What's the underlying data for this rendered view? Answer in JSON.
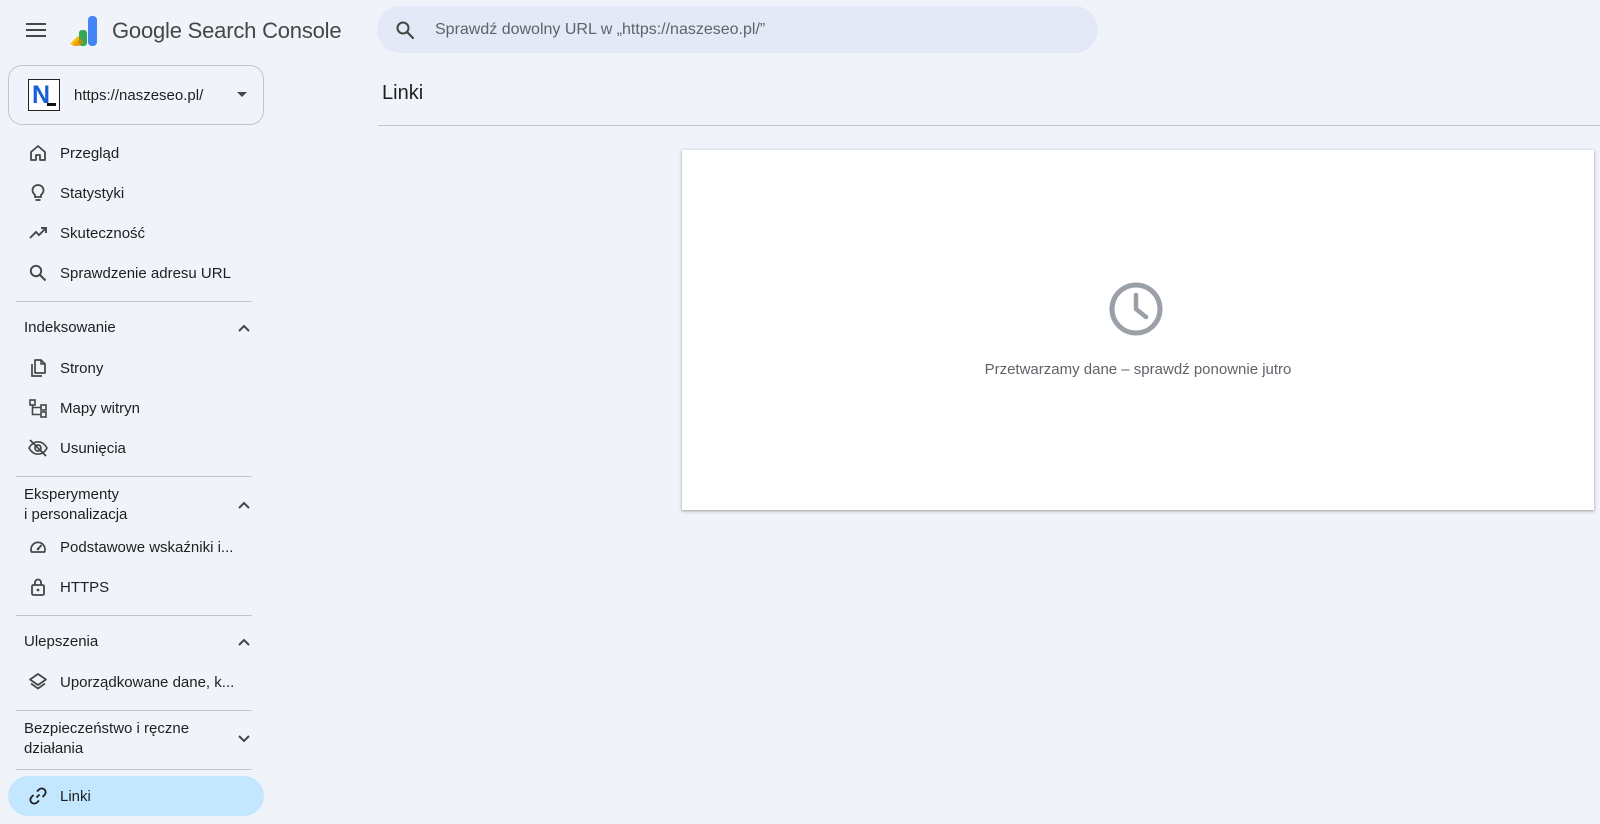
{
  "header": {
    "brand": "Google Search Console",
    "search_placeholder": "Sprawdź dowolny URL w „https://naszeseo.pl/”"
  },
  "property": {
    "label": "https://naszeseo.pl/"
  },
  "sidebar": {
    "top_items": [
      {
        "label": "Przegląd",
        "icon": "home-icon"
      },
      {
        "label": "Statystyki",
        "icon": "lightbulb-icon"
      },
      {
        "label": "Skuteczność",
        "icon": "trending-up-icon"
      },
      {
        "label": "Sprawdzenie adresu URL",
        "icon": "search-icon"
      }
    ],
    "sections": [
      {
        "title": "Indeksowanie",
        "expanded": true,
        "items": [
          {
            "label": "Strony",
            "icon": "pages-icon"
          },
          {
            "label": "Mapy witryn",
            "icon": "sitemap-icon"
          },
          {
            "label": "Usunięcia",
            "icon": "visibility-off-icon"
          }
        ]
      },
      {
        "title_line1": "Eksperymenty",
        "title_line2": "i personalizacja",
        "expanded": true,
        "items": [
          {
            "label": "Podstawowe wskaźniki i...",
            "icon": "speed-icon"
          },
          {
            "label": "HTTPS",
            "icon": "lock-icon"
          }
        ]
      },
      {
        "title": "Ulepszenia",
        "expanded": true,
        "items": [
          {
            "label": "Uporządkowane dane, k...",
            "icon": "layers-icon"
          }
        ]
      },
      {
        "title_line1": "Bezpieczeństwo i ręczne",
        "title_line2": "działania",
        "expanded": false,
        "items": []
      }
    ],
    "active_item": {
      "label": "Linki",
      "icon": "link-icon"
    }
  },
  "main": {
    "title": "Linki",
    "card_message": "Przetwarzamy dane – sprawdź ponownie jutro"
  },
  "colors": {
    "background": "#f0f3f9",
    "search_bg": "#e3e9f7",
    "active_nav": "#c2e7ff",
    "logo_blue": "#4285f4",
    "logo_green": "#34a853",
    "logo_yellow": "#fbbc04"
  }
}
